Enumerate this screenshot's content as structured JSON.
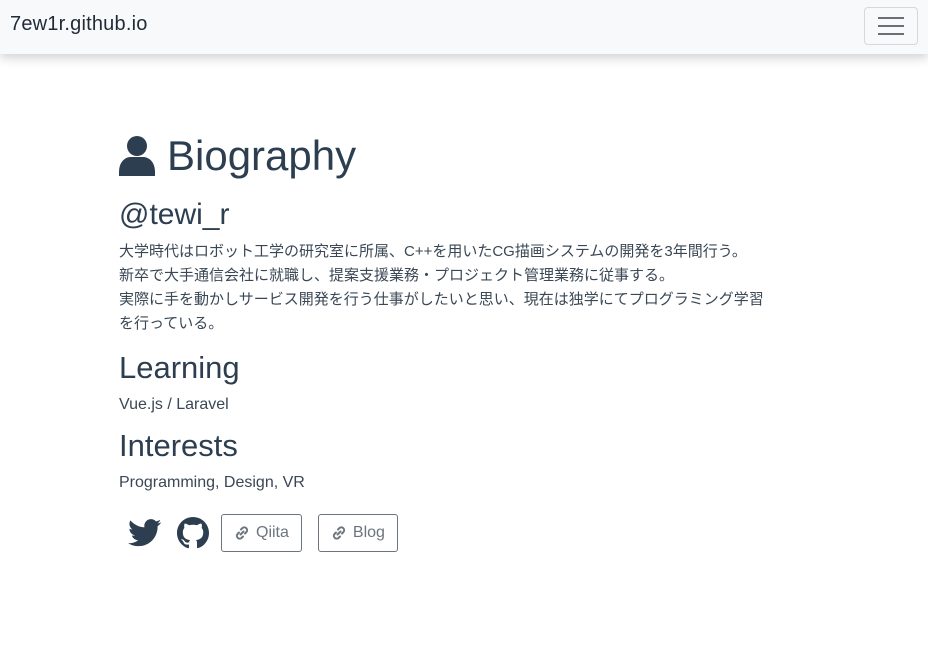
{
  "navbar": {
    "brand": "7ew1r.github.io",
    "toggler_icon": "hamburger-menu-icon"
  },
  "biography": {
    "title": "Biography",
    "title_icon": "user-icon",
    "handle": "@tewi_r",
    "bio_lines": [
      "大学時代はロボット工学の研究室に所属、C++を用いたCG描画システムの開発を3年間行う。",
      "新卒で大手通信会社に就職し、提案支援業務・プロジェクト管理業務に従事する。",
      "実際に手を動かしサービス開発を行う仕事がしたいと思い、現在は独学にてプログラミング学習",
      "を行っている。"
    ]
  },
  "learning": {
    "heading": "Learning",
    "content": "Vue.js / Laravel"
  },
  "interests": {
    "heading": "Interests",
    "content": "Programming, Design, VR"
  },
  "social": {
    "twitter_icon": "twitter-icon",
    "github_icon": "github-icon",
    "qiita_label": "Qiita",
    "blog_label": "Blog",
    "link_icon": "link-icon"
  },
  "colors": {
    "text": "#2c3e50",
    "navbar_bg": "#f8f9fa",
    "button_outline": "#6c757d"
  }
}
